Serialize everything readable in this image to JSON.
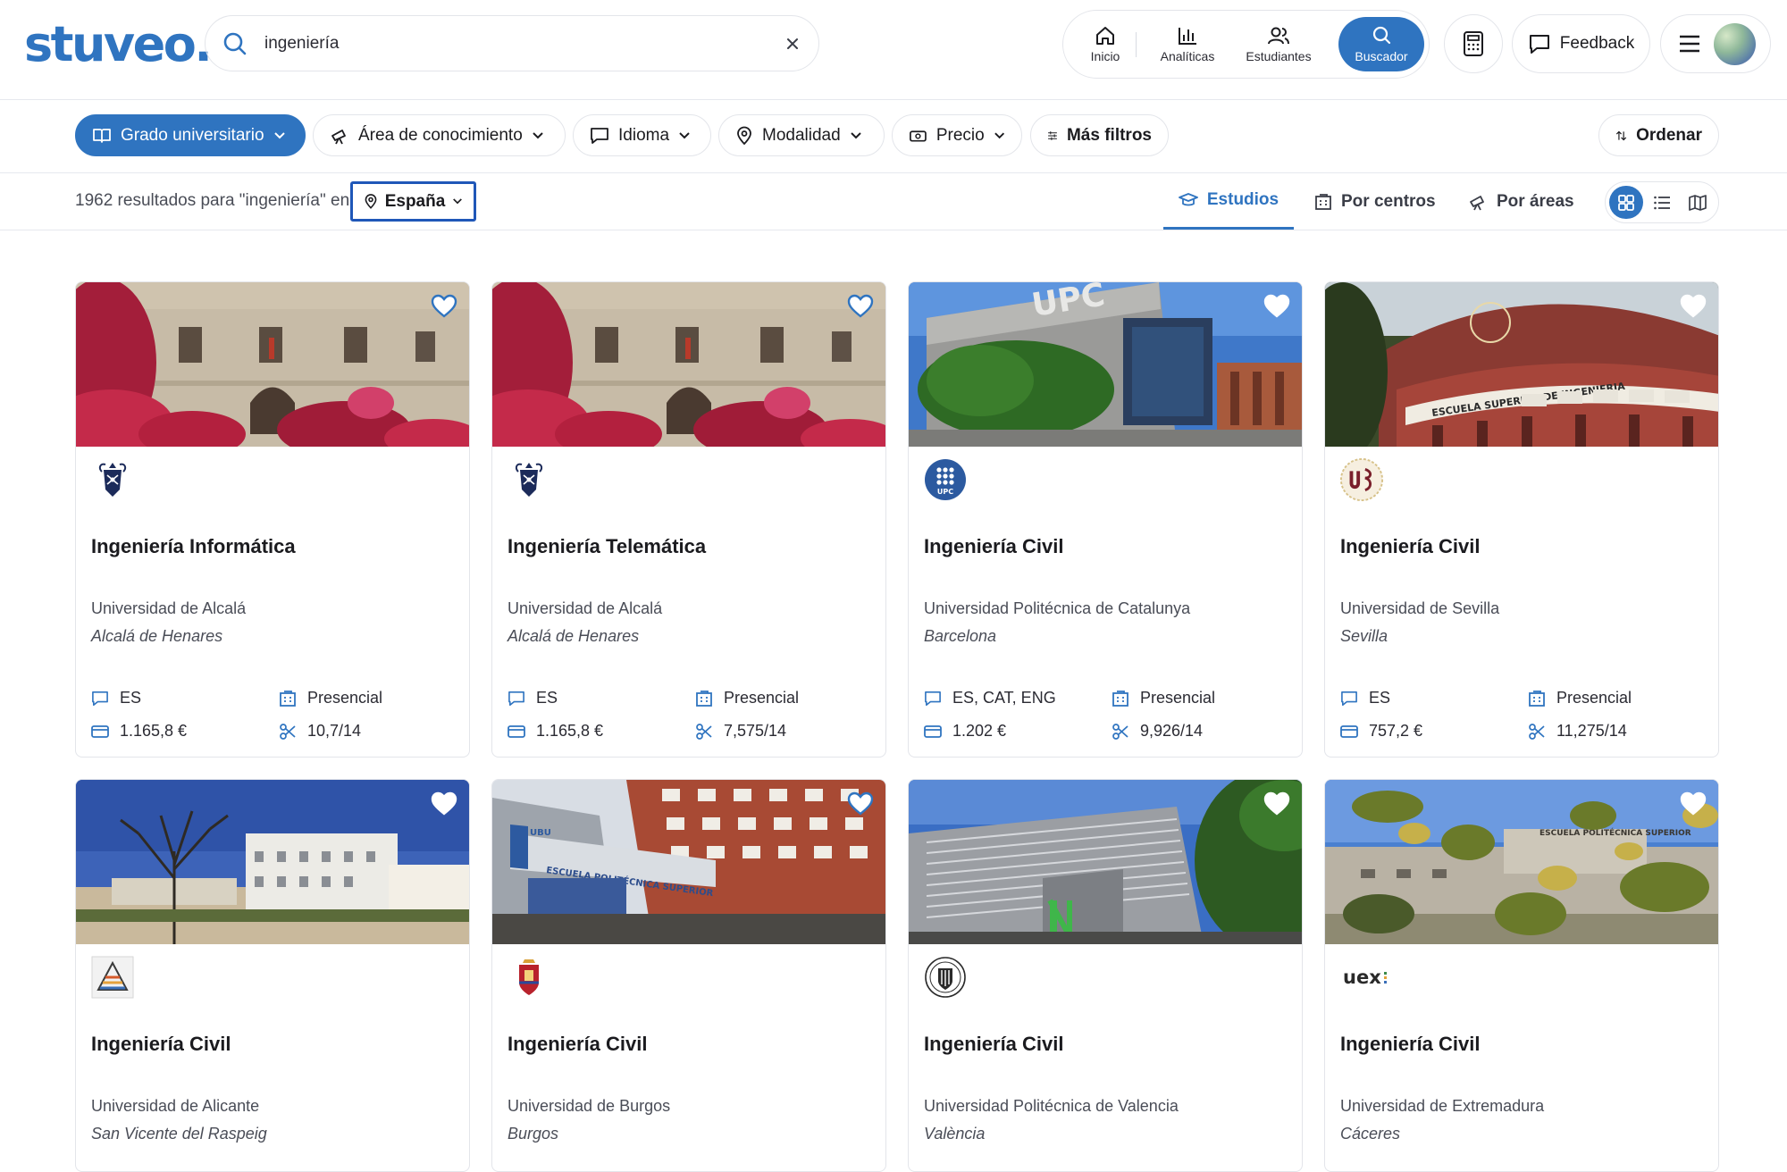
{
  "header": {
    "logo": "stuveo.",
    "search": {
      "value": "ingeniería",
      "placeholder": ""
    },
    "nav": [
      {
        "label": "Inicio",
        "icon": "home-icon"
      },
      {
        "label": "Analíticas",
        "icon": "bar-chart-icon"
      },
      {
        "label": "Estudiantes",
        "icon": "users-icon"
      },
      {
        "label": "Buscador",
        "icon": "search-icon",
        "active": true
      }
    ],
    "feedback_label": "Feedback"
  },
  "filters": {
    "grado": "Grado universitario",
    "area": "Área de conocimiento",
    "idioma": "Idioma",
    "modalidad": "Modalidad",
    "precio": "Precio",
    "mas_filtros": "Más filtros",
    "ordenar": "Ordenar"
  },
  "results": {
    "summary": "1962 resultados para \"ingeniería\" en",
    "location": "España",
    "tabs": {
      "estudios": "Estudios",
      "centros": "Por centros",
      "areas": "Por áreas"
    }
  },
  "cards": [
    {
      "title": "Ingeniería Informática",
      "university": "Universidad de Alcalá",
      "city": "Alcalá de Henares",
      "languages": "ES",
      "mode": "Presencial",
      "price": "1.165,8 €",
      "grade": "10,7/14"
    },
    {
      "title": "Ingeniería Telemática",
      "university": "Universidad de Alcalá",
      "city": "Alcalá de Henares",
      "languages": "ES",
      "mode": "Presencial",
      "price": "1.165,8 €",
      "grade": "7,575/14"
    },
    {
      "title": "Ingeniería Civil",
      "university": "Universidad Politécnica de Catalunya",
      "city": "Barcelona",
      "languages": "ES, CAT, ENG",
      "mode": "Presencial",
      "price": "1.202 €",
      "grade": "9,926/14"
    },
    {
      "title": "Ingeniería Civil",
      "university": "Universidad de Sevilla",
      "city": "Sevilla",
      "languages": "ES",
      "mode": "Presencial",
      "price": "757,2 €",
      "grade": "11,275/14"
    },
    {
      "title": "Ingeniería Civil",
      "university": "Universidad de Alicante",
      "city": "San Vicente del Raspeig"
    },
    {
      "title": "Ingeniería Civil",
      "university": "Universidad de Burgos",
      "city": "Burgos"
    },
    {
      "title": "Ingeniería Civil",
      "university": "Universidad Politécnica de Valencia",
      "city": "València"
    },
    {
      "title": "Ingeniería Civil",
      "university": "Universidad de Extremadura",
      "city": "Cáceres"
    }
  ],
  "image_text": {
    "upc_sign": "UPC",
    "upc_logo": "UPC",
    "sevilla_sign": "ESCUELA SUPERIOR DE INGENIERIA",
    "burgos_sign": "ESCUELA POLITÉCNICA SUPERIOR",
    "burgos_ubu": "UBU",
    "extremadura_logo": "uex"
  },
  "colors": {
    "accent": "#2f74c0",
    "focus_ring": "#1f57b8",
    "border": "#e3e5ea",
    "text_muted": "#4a4d57"
  }
}
